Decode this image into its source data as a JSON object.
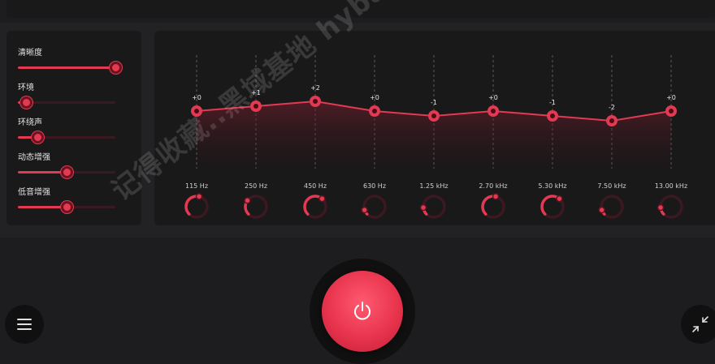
{
  "colors": {
    "accent": "#e23a52",
    "accent_dark": "#6b1420",
    "panel": "#19191a",
    "background": "#1d1d1f"
  },
  "enhancers": [
    {
      "label": "清晰度",
      "value": 1.0
    },
    {
      "label": "环境",
      "value": 0.08
    },
    {
      "label": "环绕声",
      "value": 0.2
    },
    {
      "label": "动态增强",
      "value": 0.5
    },
    {
      "label": "低音增强",
      "value": 0.5
    }
  ],
  "equalizer": {
    "bands": [
      {
        "freq": "115 Hz",
        "gain_label": "+0",
        "gain": 0,
        "knob": 0.55
      },
      {
        "freq": "250 Hz",
        "gain_label": "+1",
        "gain": 1,
        "knob": 0.3
      },
      {
        "freq": "450 Hz",
        "gain_label": "+2",
        "gain": 2,
        "knob": 0.65
      },
      {
        "freq": "630 Hz",
        "gain_label": "+0",
        "gain": 0,
        "knob": 0.1
      },
      {
        "freq": "1.25 kHz",
        "gain_label": "-1",
        "gain": -1,
        "knob": 0.15
      },
      {
        "freq": "2.70 kHz",
        "gain_label": "+0",
        "gain": 0,
        "knob": 0.55
      },
      {
        "freq": "5.30 kHz",
        "gain_label": "-1",
        "gain": -1,
        "knob": 0.65
      },
      {
        "freq": "7.50 kHz",
        "gain_label": "-2",
        "gain": -2,
        "knob": 0.1
      },
      {
        "freq": "13.00 kHz",
        "gain_label": "+0",
        "gain": 0,
        "knob": 0.15
      }
    ]
  },
  "power": {
    "icon": "power-icon",
    "state": "on"
  },
  "menu": {
    "icon": "menu-icon"
  },
  "collapse": {
    "icon": "collapse-arrows-icon"
  },
  "watermark": "记得收藏..黑域基地 hybase.com"
}
